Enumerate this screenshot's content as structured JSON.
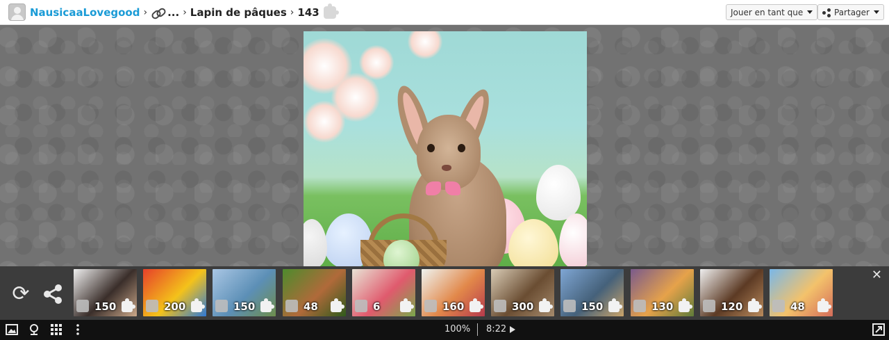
{
  "breadcrumb": {
    "user": "NausicaaLovegood",
    "ellipsis": "...",
    "title": "Lapin de pâques",
    "pieces": "143"
  },
  "header": {
    "play_as_label": "Jouer en tant que",
    "share_label": "Partager"
  },
  "strip": {
    "thumbnails": [
      {
        "count": "150",
        "colors": [
          "#efefef",
          "#3a2e2a",
          "#caa88a"
        ]
      },
      {
        "count": "200",
        "colors": [
          "#e6402a",
          "#f4c21a",
          "#2f79d6"
        ]
      },
      {
        "count": "150",
        "colors": [
          "#a9c6e4",
          "#5c8fb6",
          "#6e8e4c"
        ]
      },
      {
        "count": "48",
        "colors": [
          "#4d8b2d",
          "#b06a3a",
          "#2f5a1c"
        ]
      },
      {
        "count": "6",
        "colors": [
          "#e8e3d5",
          "#e05a6d",
          "#7aa84c"
        ]
      },
      {
        "count": "160",
        "colors": [
          "#eef3f0",
          "#e2884a",
          "#b63a4c"
        ]
      },
      {
        "count": "300",
        "colors": [
          "#d8cbb5",
          "#6a4d32",
          "#a58a6c"
        ]
      },
      {
        "count": "150",
        "colors": [
          "#7fa6d4",
          "#45617a",
          "#c9a36a"
        ]
      },
      {
        "count": "130",
        "colors": [
          "#7a5a8c",
          "#e6a24a",
          "#5f7b3a"
        ]
      },
      {
        "count": "120",
        "colors": [
          "#efefef",
          "#5c3a24",
          "#b98a5c"
        ]
      },
      {
        "count": "48",
        "colors": [
          "#79b7e8",
          "#f3c26b",
          "#d46c5a"
        ]
      }
    ]
  },
  "footer": {
    "zoom": "100%",
    "time": "8:22"
  },
  "colors": {
    "link": "#1a9bd6",
    "strip_bg": "#3c3c3c",
    "footer_bg": "#111111"
  }
}
